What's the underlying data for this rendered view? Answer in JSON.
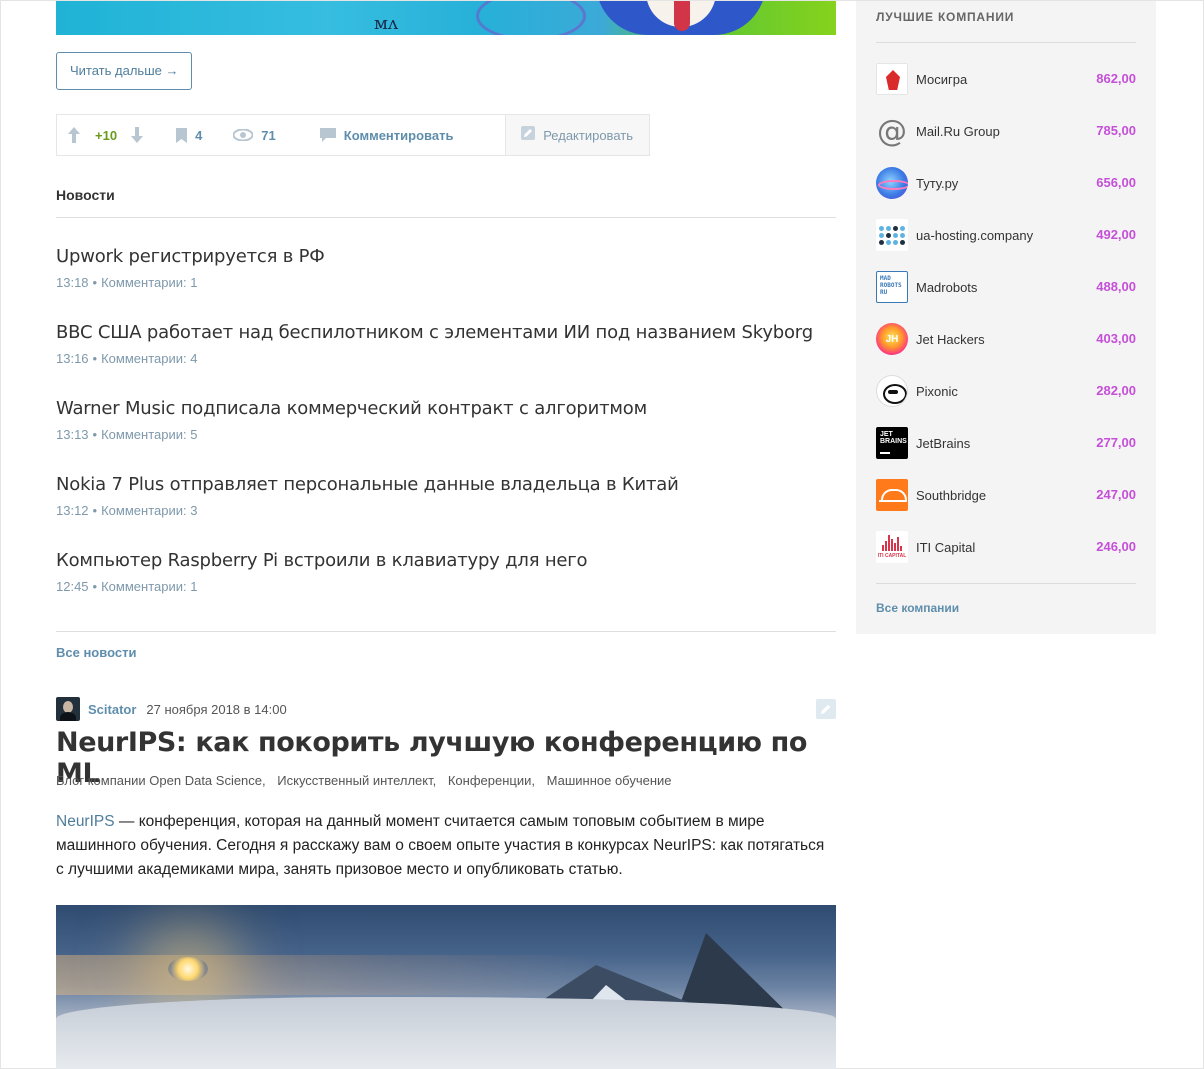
{
  "post_footer": {
    "read_more": "Читать дальше →",
    "score": "+10",
    "bookmarks": "4",
    "views": "71",
    "comment_label": "Комментировать",
    "edit_label": "Редактировать"
  },
  "news": {
    "heading": "Новости",
    "items": [
      {
        "title": "Upwork регистрируется в РФ",
        "time": "13:18",
        "comments": "Комментарии: 1"
      },
      {
        "title": "BBC США работает над беспилотником с элементами ИИ под названием Skyborg",
        "time": "13:16",
        "comments": "Комментарии: 4"
      },
      {
        "title": "Warner Music подписала коммерческий контракт с алгоритмом",
        "time": "13:13",
        "comments": "Комментарии: 5"
      },
      {
        "title": "Nokia 7 Plus отправляет персональные данные владельца в Китай",
        "time": "13:12",
        "comments": "Комментарии: 3"
      },
      {
        "title": "Компьютер Raspberry Pi встроили в клавиатуру для него",
        "time": "12:45",
        "comments": "Комментарии: 1"
      }
    ],
    "all_link": "Все новости"
  },
  "post": {
    "author": "Scitator",
    "date": "27 ноября 2018 в 14:00",
    "title": "NeurIPS: как покорить лучшую конференцию по ML",
    "hubs": [
      "Блог компании Open Data Science,",
      "Искусственный интеллект,",
      "Конференции,",
      "Машинное обучение"
    ],
    "lead_link": "NeurIPS",
    "lead_text": " — конференция, которая на данный момент считается самым топовым событием в мире машинного обучения. Сегодня я расскажу вам о своем опыте участия в конкурсах NeurIPS: как потягаться с лучшими академиками мира, занять призовое место и опубликовать статью."
  },
  "sidebar": {
    "title": "ЛУЧШИЕ КОМПАНИИ",
    "companies": [
      {
        "name": "Мосигра",
        "rating": "862,00"
      },
      {
        "name": "Mail.Ru Group",
        "rating": "785,00"
      },
      {
        "name": "Туту.ру",
        "rating": "656,00"
      },
      {
        "name": "ua-hosting.company",
        "rating": "492,00"
      },
      {
        "name": "Madrobots",
        "rating": "488,00"
      },
      {
        "name": "Jet Hackers",
        "rating": "403,00"
      },
      {
        "name": "Pixonic",
        "rating": "282,00"
      },
      {
        "name": "JetBrains",
        "rating": "277,00"
      },
      {
        "name": "Southbridge",
        "rating": "247,00"
      },
      {
        "name": "ITI Capital",
        "rating": "246,00"
      }
    ],
    "all_link": "Все компании"
  },
  "logos": {
    "banner_scribble": "ᴍᴧ",
    "mail_glyph": "@",
    "madrobots_text": "MAD ROBOTS RU",
    "jethackers_text": "JH",
    "jetbrains_text": "JET BRAINS",
    "iti_caption": "ITI CAPITAL"
  }
}
